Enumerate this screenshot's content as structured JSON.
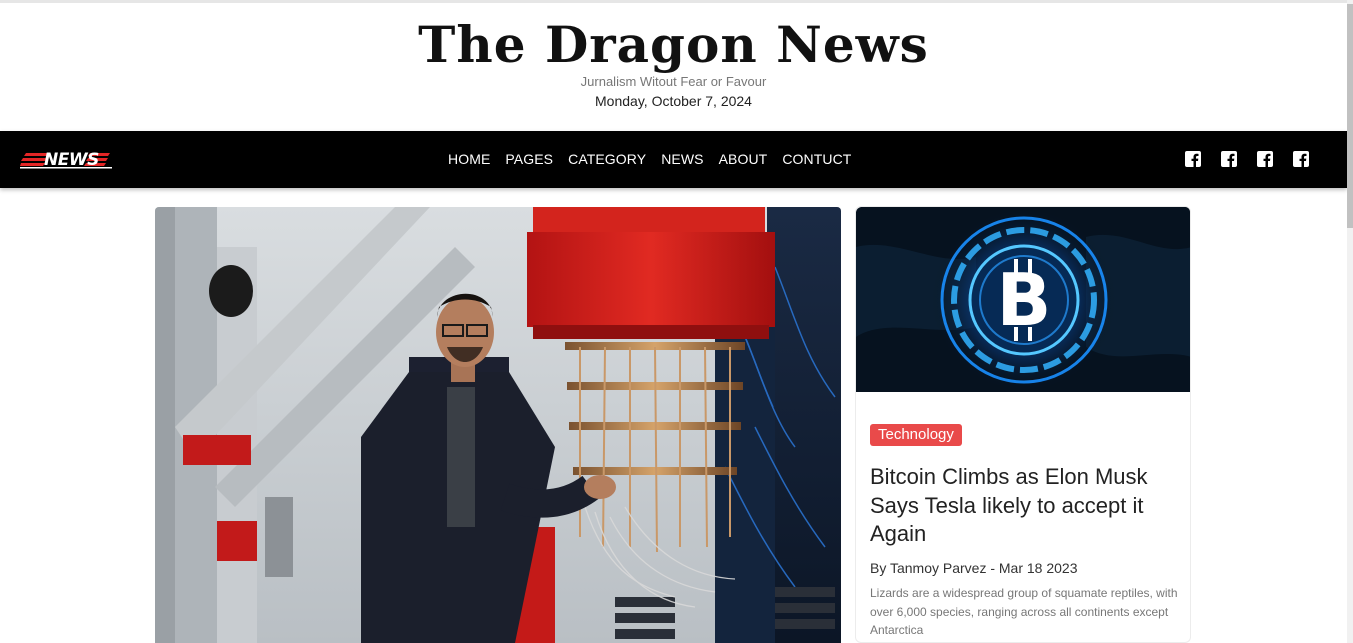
{
  "header": {
    "site_title": "The Dragon News",
    "tagline": "Jurnalism Witout Fear or Favour",
    "date": "Monday, October 7, 2024"
  },
  "navbar": {
    "logo_text": "NEWS",
    "links": [
      "HOME",
      "PAGES",
      "CATEGORY",
      "NEWS",
      "ABOUT",
      "CONTUCT"
    ],
    "social_icons": [
      "facebook-icon",
      "facebook-icon",
      "facebook-icon",
      "facebook-icon"
    ]
  },
  "colors": {
    "navbar_bg": "#000000",
    "badge_bg": "#e94a4a",
    "accent_red": "#d42a2a"
  },
  "featured_card": {
    "category": "Technology",
    "title": "Bitcoin Climbs as Elon Musk Says Tesla likely to accept it Again",
    "byline": "By Tanmoy Parvez - Mar 18 2023",
    "excerpt": "Lizards are a widespread group of squamate reptiles, with over 6,000 species, ranging across all continents except Antarctica"
  },
  "bitcoin_image": {
    "symbol": "B"
  }
}
